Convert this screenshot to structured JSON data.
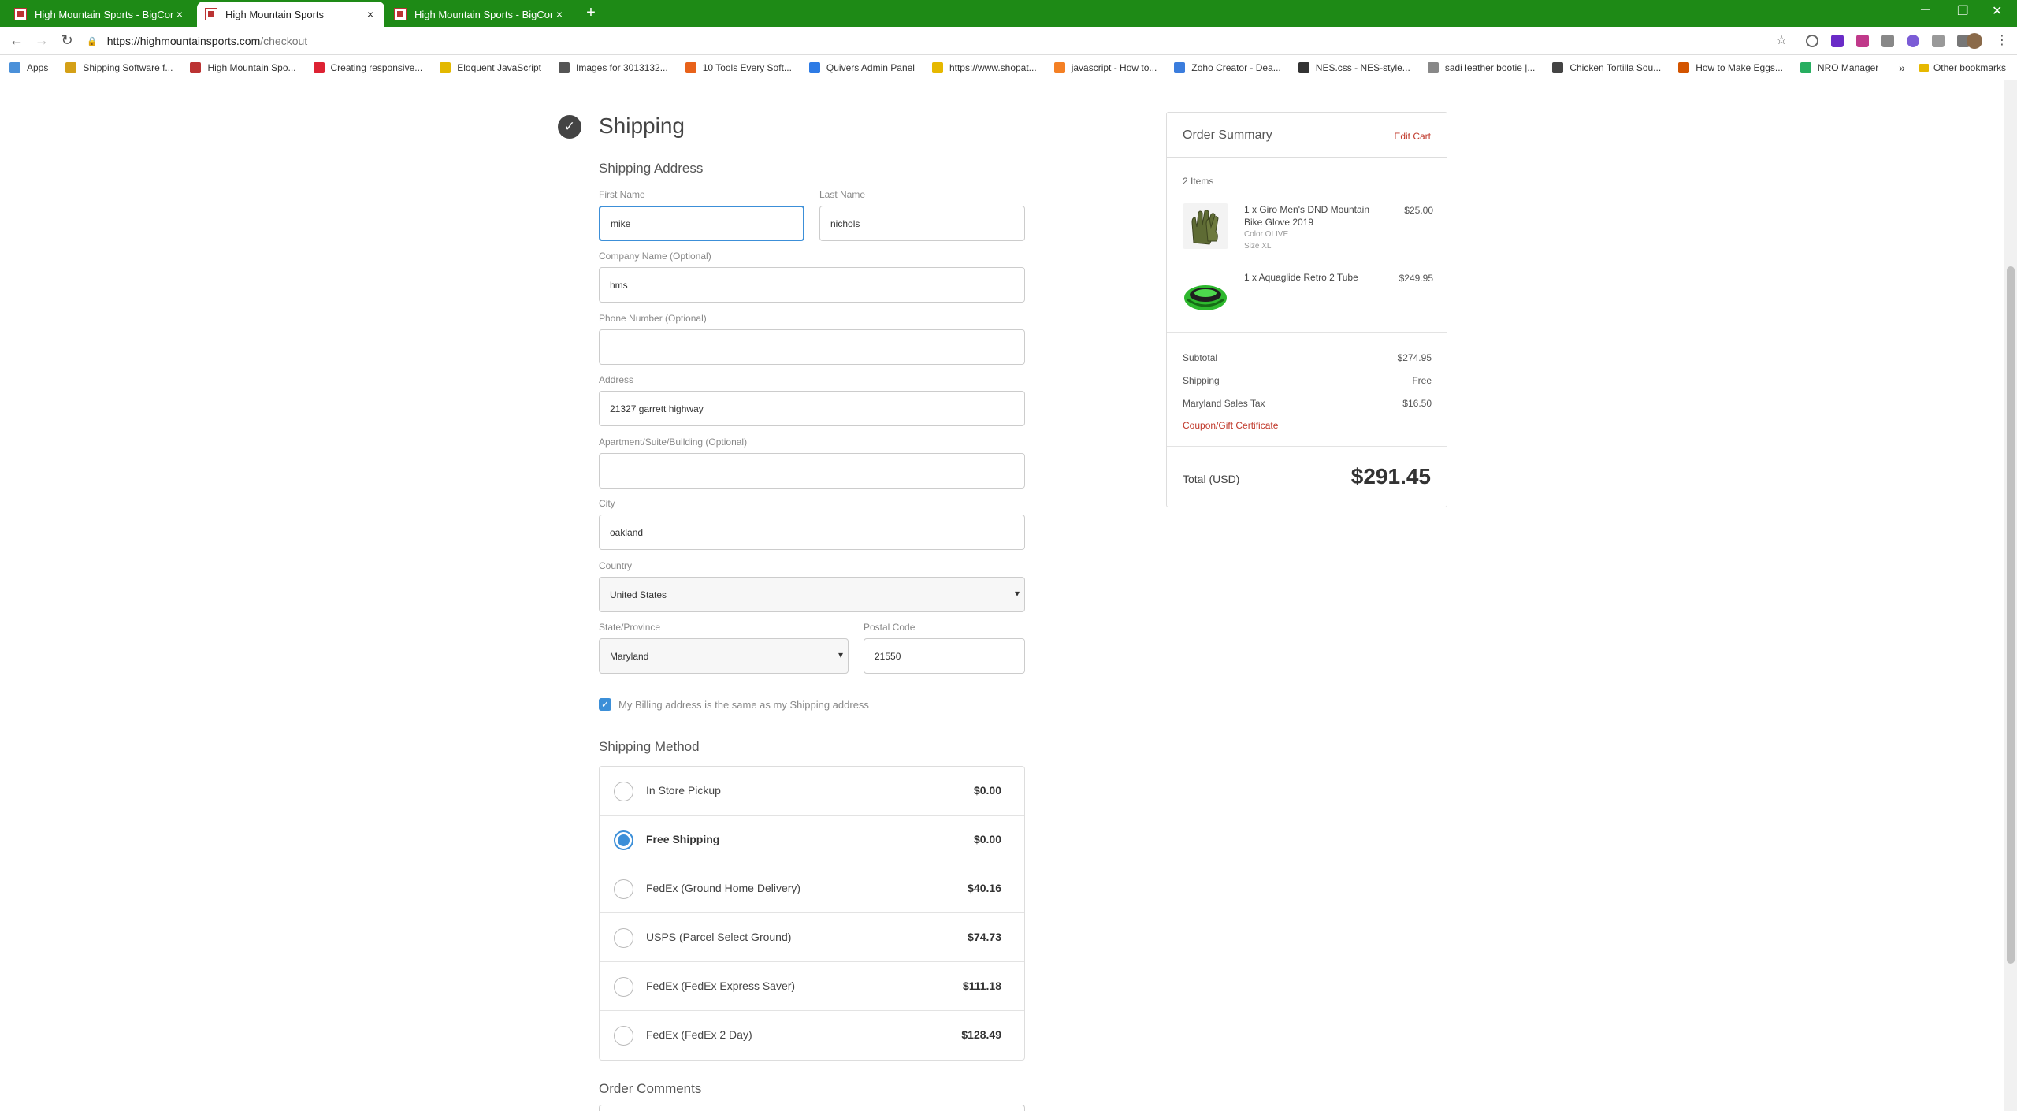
{
  "browser": {
    "tabs": [
      {
        "title": "High Mountain Sports - BigCommerce",
        "close": "×"
      },
      {
        "title": "High Mountain Sports",
        "close": "×"
      },
      {
        "title": "High Mountain Sports - BigCommerce",
        "close": "×"
      }
    ],
    "new_tab": "+",
    "url_host": "https://highmountainsports.com",
    "url_path": "/checkout",
    "bookmarks": [
      {
        "label": "Apps",
        "color": "#4a90d9"
      },
      {
        "label": "Shipping Software f...",
        "color": "#d4a017"
      },
      {
        "label": "High Mountain Spo...",
        "color": "#b33"
      },
      {
        "label": "Creating responsive...",
        "color": "#d23"
      },
      {
        "label": "Eloquent JavaScript",
        "color": "#e3b800"
      },
      {
        "label": "Images for 3013132...",
        "color": "#555"
      },
      {
        "label": "10 Tools Every Soft...",
        "color": "#e8621a"
      },
      {
        "label": "Quivers Admin Panel",
        "color": "#2d7be5"
      },
      {
        "label": "https://www.shopat...",
        "color": "#e6b800"
      },
      {
        "label": "javascript - How to...",
        "color": "#f48024"
      },
      {
        "label": "Zoho Creator - Dea...",
        "color": "#3b7ddd"
      },
      {
        "label": "NES.css - NES-style...",
        "color": "#333"
      },
      {
        "label": "sadi leather bootie |...",
        "color": "#888"
      },
      {
        "label": "Chicken Tortilla Sou...",
        "color": "#444"
      },
      {
        "label": "How to Make Eggs...",
        "color": "#d35400"
      },
      {
        "label": "NRO Manager",
        "color": "#27ae60"
      }
    ],
    "other_bookmarks": "Other bookmarks",
    "more_bookmarks": "»"
  },
  "shipping": {
    "step_title": "Shipping",
    "address_title": "Shipping Address",
    "fields": {
      "first_name": {
        "label": "First Name",
        "value": "mike"
      },
      "last_name": {
        "label": "Last Name",
        "value": "nichols"
      },
      "company": {
        "label": "Company Name (Optional)",
        "value": "hms"
      },
      "phone": {
        "label": "Phone Number (Optional)",
        "value": ""
      },
      "address": {
        "label": "Address",
        "value": "21327 garrett highway"
      },
      "apartment": {
        "label": "Apartment/Suite/Building (Optional)",
        "value": ""
      },
      "city": {
        "label": "City",
        "value": "oakland"
      },
      "country": {
        "label": "Country",
        "value": "United States"
      },
      "state": {
        "label": "State/Province",
        "value": "Maryland"
      },
      "postal": {
        "label": "Postal Code",
        "value": "21550"
      }
    },
    "billing_same_label": "My Billing address is the same as my Shipping address",
    "billing_same_checked": true,
    "method_title": "Shipping Method",
    "methods": [
      {
        "name": "In Store Pickup",
        "price": "$0.00",
        "selected": false
      },
      {
        "name": "Free Shipping",
        "price": "$0.00",
        "selected": true
      },
      {
        "name": "FedEx (Ground Home Delivery)",
        "price": "$40.16",
        "selected": false
      },
      {
        "name": "USPS (Parcel Select Ground)",
        "price": "$74.73",
        "selected": false
      },
      {
        "name": "FedEx (FedEx Express Saver)",
        "price": "$111.18",
        "selected": false
      },
      {
        "name": "FedEx (FedEx 2 Day)",
        "price": "$128.49",
        "selected": false
      }
    ],
    "comments_title": "Order Comments"
  },
  "summary": {
    "title": "Order Summary",
    "edit_cart": "Edit Cart",
    "items_count": "2 Items",
    "items": [
      {
        "name": "1 x Giro Men's DND Mountain Bike Glove 2019",
        "attr1": "Color OLIVE",
        "attr2": "Size XL",
        "price": "$25.00"
      },
      {
        "name": "1 x Aquaglide Retro 2 Tube",
        "attr1": "",
        "attr2": "",
        "price": "$249.95"
      }
    ],
    "subtotal_label": "Subtotal",
    "subtotal": "$274.95",
    "shipping_label": "Shipping",
    "shipping": "Free",
    "tax_label": "Maryland Sales Tax",
    "tax": "$16.50",
    "coupon": "Coupon/Gift Certificate",
    "total_label": "Total (USD)",
    "total": "$291.45"
  }
}
